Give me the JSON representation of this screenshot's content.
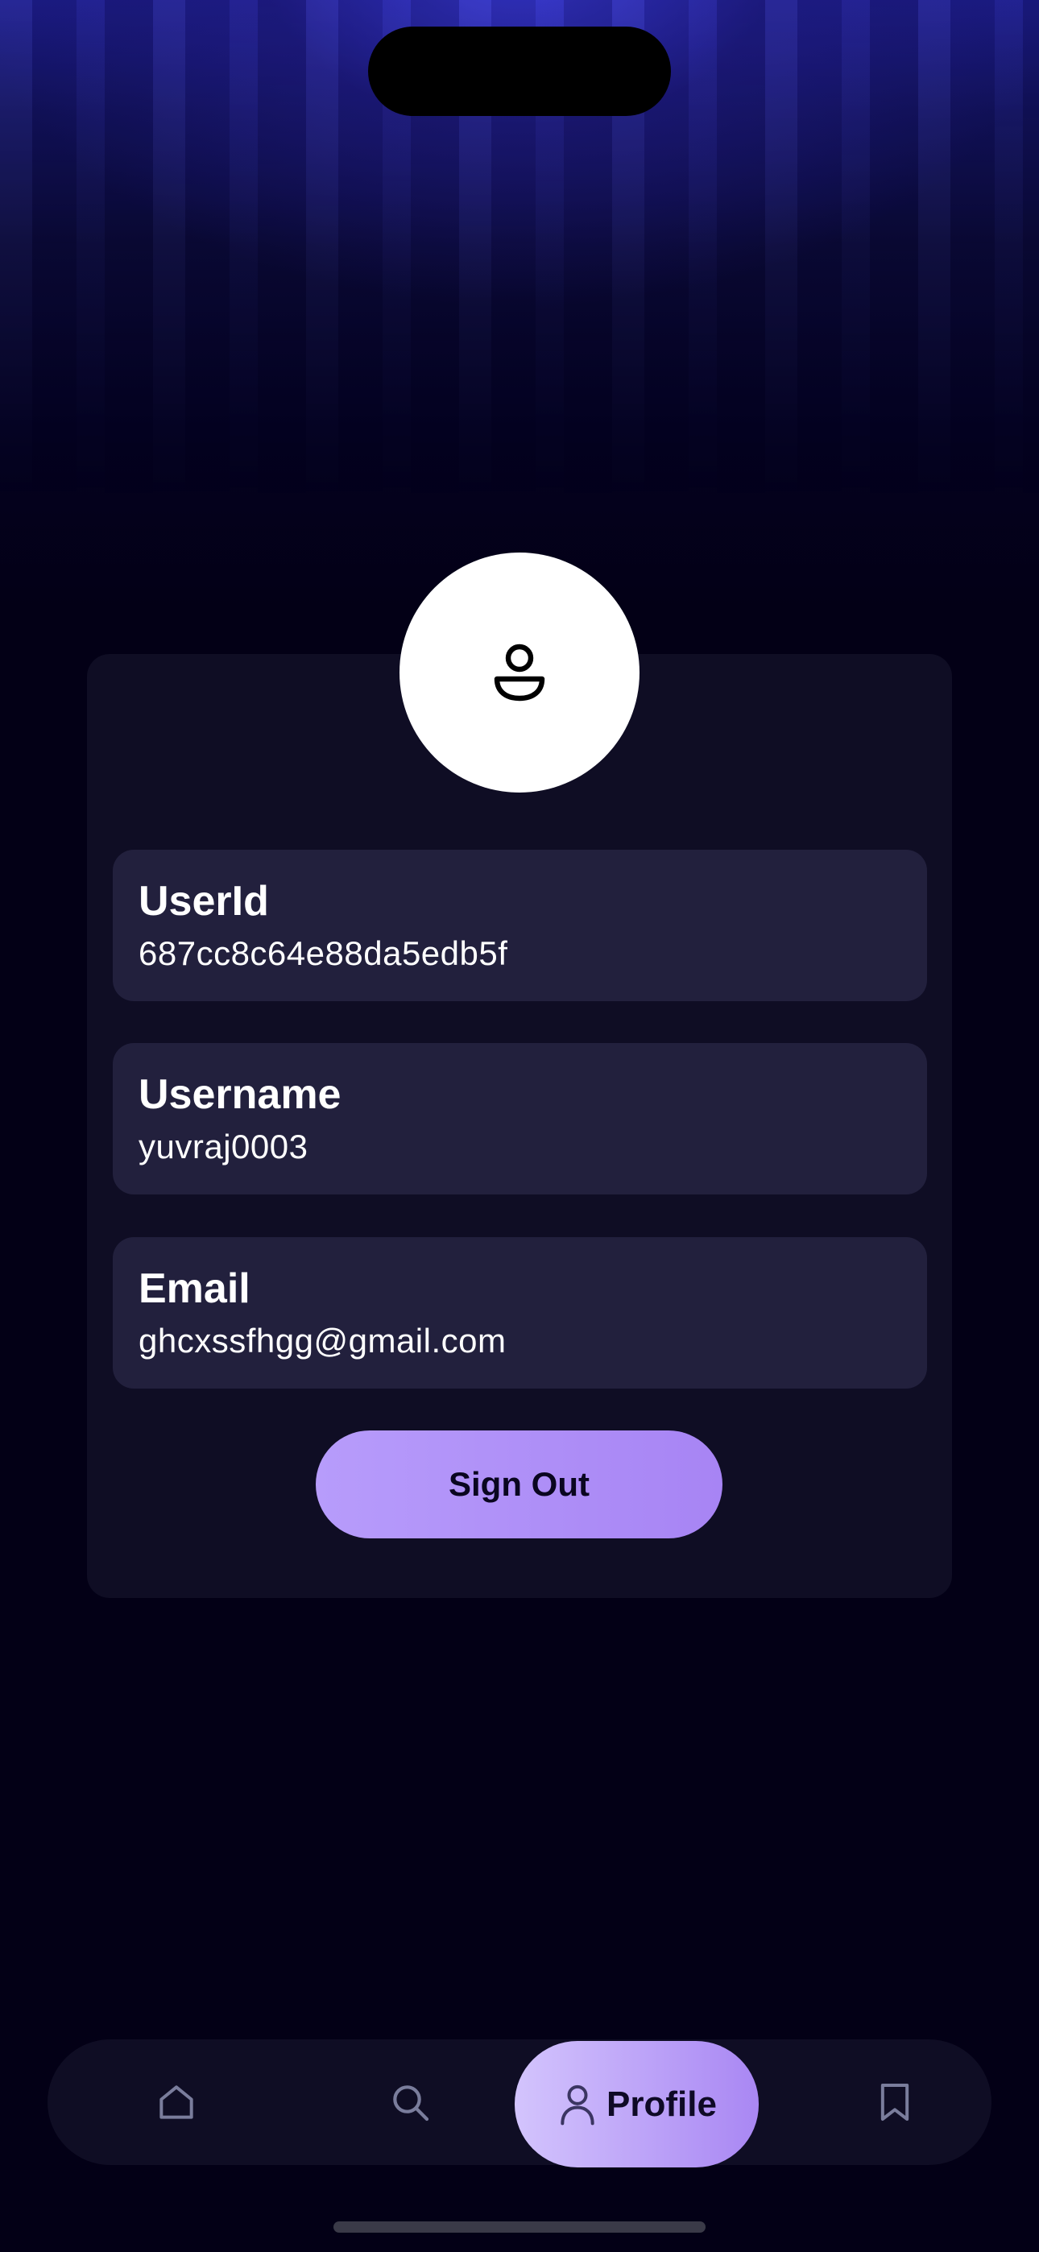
{
  "profile": {
    "fields": [
      {
        "label": "UserId",
        "value": "687cc8c64e88da5edb5f"
      },
      {
        "label": "Username",
        "value": "yuvraj0003"
      },
      {
        "label": "Email",
        "value": "ghcxssfhgg@gmail.com"
      }
    ],
    "avatar_icon": "user-icon",
    "sign_out_label": "Sign Out"
  },
  "tabbar": {
    "items": [
      {
        "icon": "home-icon"
      },
      {
        "icon": "search-icon"
      },
      {
        "icon": "user-icon",
        "label": "Profile",
        "active": true
      },
      {
        "icon": "bookmark-icon"
      }
    ]
  },
  "colors": {
    "background": "#030016",
    "card": "#0f0d24",
    "field": "#22203d",
    "accent": "#a784f4"
  }
}
